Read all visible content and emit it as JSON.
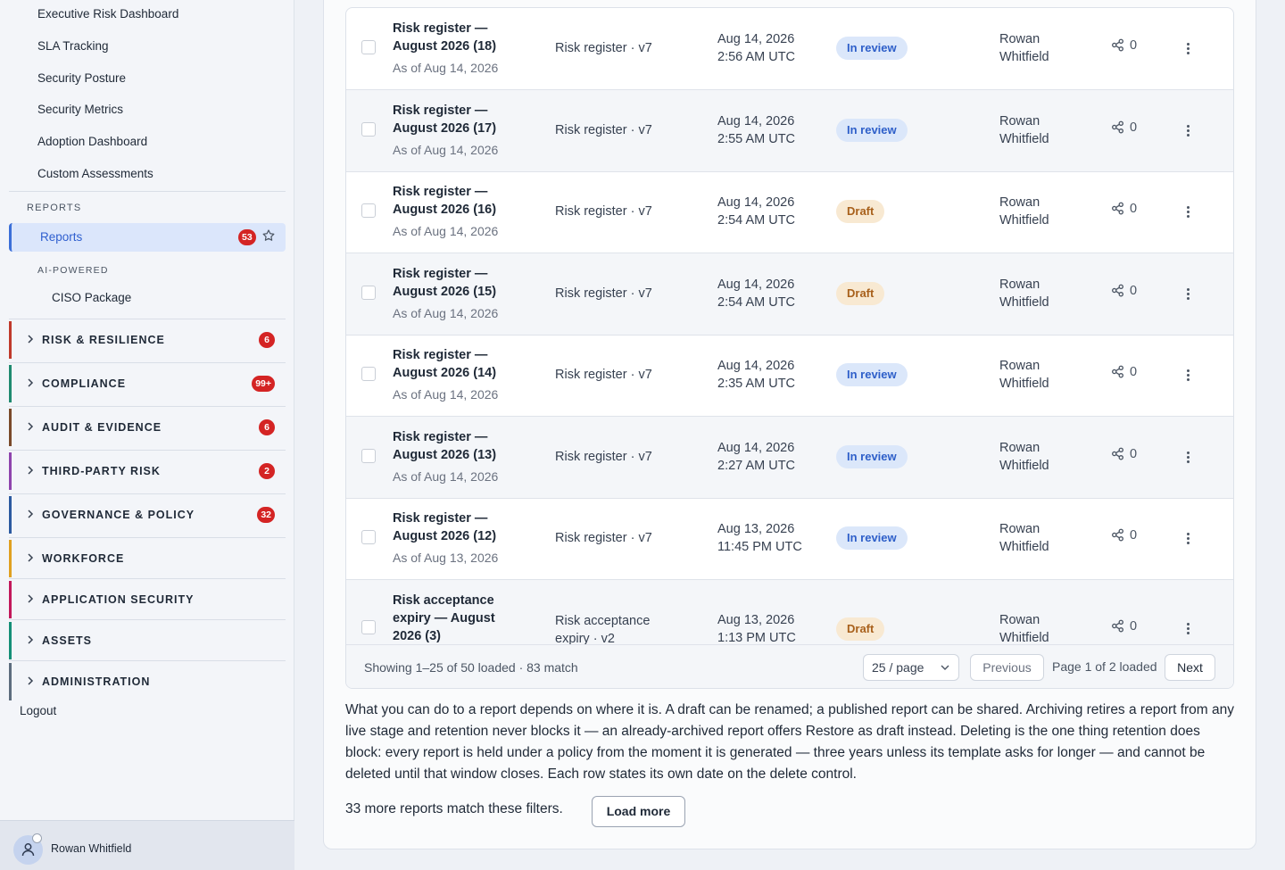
{
  "sidebar": {
    "links": [
      "Executive Risk Dashboard",
      "SLA Tracking",
      "Security Posture",
      "Security Metrics",
      "Adoption Dashboard",
      "Custom Assessments"
    ],
    "reports_section_label": "REPORTS",
    "reports_item": {
      "label": "Reports",
      "badge": "53",
      "icon": "star-icon"
    },
    "ai_label": "AI-POWERED",
    "ai_items": [
      "CISO Package"
    ],
    "groups": [
      {
        "label": "RISK & RESILIENCE",
        "badge": "6",
        "color": "#c0392b"
      },
      {
        "label": "COMPLIANCE",
        "badge": "99+",
        "color": "#1f8a70"
      },
      {
        "label": "AUDIT & EVIDENCE",
        "badge": "6",
        "color": "#7a4a2a"
      },
      {
        "label": "THIRD-PARTY RISK",
        "badge": "2",
        "color": "#8e44ad"
      },
      {
        "label": "GOVERNANCE & POLICY",
        "badge": "32",
        "color": "#2c5aa0"
      },
      {
        "label": "WORKFORCE",
        "badge": "",
        "color": "#e0a020"
      },
      {
        "label": "APPLICATION SECURITY",
        "badge": "",
        "color": "#c2185b"
      },
      {
        "label": "ASSETS",
        "badge": "",
        "color": "#148f77"
      },
      {
        "label": "ADMINISTRATION",
        "badge": "",
        "color": "#5d6d7e"
      }
    ],
    "logout": "Logout",
    "user": {
      "name": "Rowan Whitfield"
    }
  },
  "table": {
    "rows": [
      {
        "title": "Risk register — August 2026 (18)",
        "as_of": "As of Aug 14, 2026",
        "template": "Risk register · v7",
        "date": "Aug 14, 2026",
        "time": "2:56 AM UTC",
        "status": "In review",
        "owner": "Rowan Whitfield",
        "shares": "0"
      },
      {
        "title": "Risk register — August 2026 (17)",
        "as_of": "As of Aug 14, 2026",
        "template": "Risk register · v7",
        "date": "Aug 14, 2026",
        "time": "2:55 AM UTC",
        "status": "In review",
        "owner": "Rowan Whitfield",
        "shares": "0"
      },
      {
        "title": "Risk register — August 2026 (16)",
        "as_of": "As of Aug 14, 2026",
        "template": "Risk register · v7",
        "date": "Aug 14, 2026",
        "time": "2:54 AM UTC",
        "status": "Draft",
        "owner": "Rowan Whitfield",
        "shares": "0"
      },
      {
        "title": "Risk register — August 2026 (15)",
        "as_of": "As of Aug 14, 2026",
        "template": "Risk register · v7",
        "date": "Aug 14, 2026",
        "time": "2:54 AM UTC",
        "status": "Draft",
        "owner": "Rowan Whitfield",
        "shares": "0"
      },
      {
        "title": "Risk register — August 2026 (14)",
        "as_of": "As of Aug 14, 2026",
        "template": "Risk register · v7",
        "date": "Aug 14, 2026",
        "time": "2:35 AM UTC",
        "status": "In review",
        "owner": "Rowan Whitfield",
        "shares": "0"
      },
      {
        "title": "Risk register — August 2026 (13)",
        "as_of": "As of Aug 14, 2026",
        "template": "Risk register · v7",
        "date": "Aug 14, 2026",
        "time": "2:27 AM UTC",
        "status": "In review",
        "owner": "Rowan Whitfield",
        "shares": "0"
      },
      {
        "title": "Risk register — August 2026 (12)",
        "as_of": "As of Aug 13, 2026",
        "template": "Risk register · v7",
        "date": "Aug 13, 2026",
        "time": "11:45 PM UTC",
        "status": "In review",
        "owner": "Rowan Whitfield",
        "shares": "0"
      },
      {
        "title": "Risk acceptance expiry — August 2026 (3)",
        "as_of": "",
        "template": "Risk acceptance expiry · v2",
        "date": "Aug 13, 2026",
        "time": "1:13 PM UTC",
        "status": "Draft",
        "owner": "Rowan Whitfield",
        "shares": "0"
      }
    ],
    "footer": {
      "summary": "Showing 1–25 of 50 loaded · 83 match",
      "page_size": "25 / page",
      "previous": "Previous",
      "page_info": "Page 1 of 2 loaded",
      "next": "Next"
    }
  },
  "description": "What you can do to a report depends on where it is. A draft can be renamed; a published report can be shared. Archiving retires a report from any live stage and retention never blocks it — an already-archived report offers Restore as draft instead. Deleting is the one thing retention does block: every report is held under a policy from the moment it is generated — three years unless its template asks for longer — and cannot be deleted until that window closes. Each row states its own date on the delete control.",
  "more_reports": {
    "text": "33 more reports match these filters.",
    "button": "Load more"
  },
  "colors": {
    "accent": "#3b6fd8",
    "badge": "#d42424",
    "review": "#2e5fc9",
    "draft": "#a8601b"
  }
}
